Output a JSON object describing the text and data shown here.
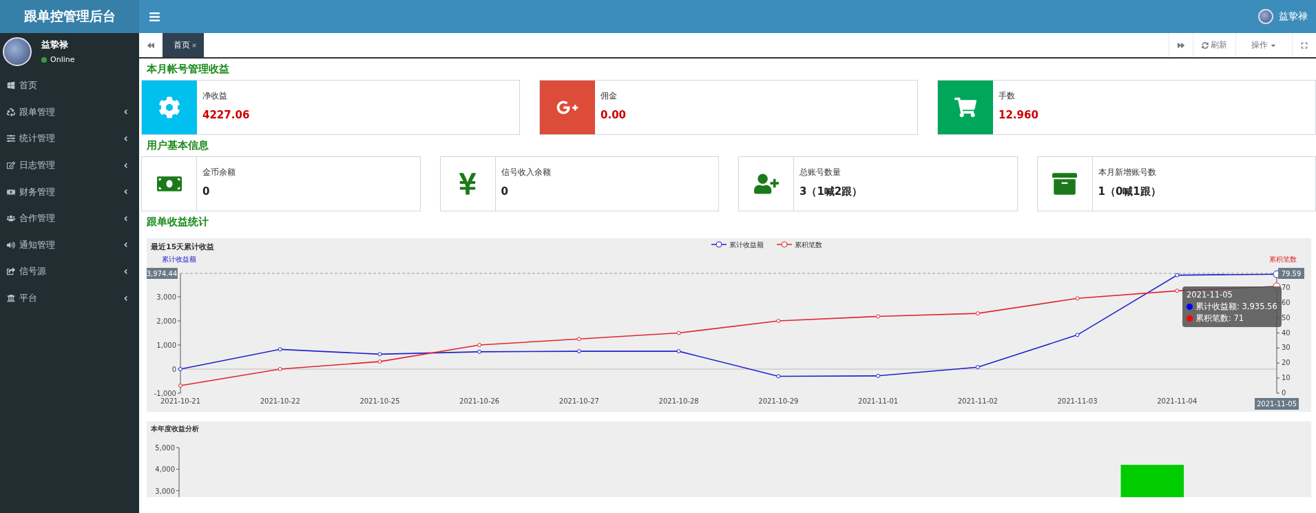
{
  "header": {
    "logo": "跟单控管理后台",
    "user_name": "益挚禄"
  },
  "sidebar": {
    "user": {
      "name": "益挚禄",
      "status": "Online",
      "online": true
    },
    "items": [
      {
        "label": "首页",
        "expandable": false
      },
      {
        "label": "跟单管理",
        "expandable": true
      },
      {
        "label": "统计管理",
        "expandable": true
      },
      {
        "label": "日志管理",
        "expandable": true
      },
      {
        "label": "财务管理",
        "expandable": true
      },
      {
        "label": "合作管理",
        "expandable": true
      },
      {
        "label": "通知管理",
        "expandable": true
      },
      {
        "label": "信号源",
        "expandable": true
      },
      {
        "label": "平台",
        "expandable": true
      }
    ]
  },
  "tab_bar": {
    "tabs": [
      {
        "label": "首页",
        "selected": true
      }
    ],
    "refresh": "刷新",
    "actions": "操作"
  },
  "sections": [
    {
      "title": "本月帐号管理收益",
      "kind": "colored",
      "cards": [
        {
          "label": "净收益",
          "value": "4227.06",
          "color": "#00c0ef"
        },
        {
          "label": "佣金",
          "value": "0.00",
          "color": "#dd4b39"
        },
        {
          "label": "手数",
          "value": "12.960",
          "color": "#00a65a"
        }
      ]
    },
    {
      "title": "用户基本信息",
      "kind": "plain",
      "cards": [
        {
          "label": "金币余额",
          "value": "0"
        },
        {
          "label": "信号收入余额",
          "value": "0"
        },
        {
          "label": "总账号数量",
          "value": "3（1喊2跟）"
        },
        {
          "label": "本月新增账号数",
          "value": "1（0喊1跟）"
        }
      ]
    },
    {
      "title": "跟单收益统计",
      "kind": "charts"
    }
  ],
  "charts": [
    {
      "chart_data": {
        "type": "line",
        "title": "最近15天累计收益",
        "categories": [
          "2021-10-21",
          "2021-10-22",
          "2021-10-25",
          "2021-10-26",
          "2021-10-27",
          "2021-10-28",
          "2021-10-29",
          "2021-11-01",
          "2021-11-02",
          "2021-11-03",
          "2021-11-04",
          "2021-11-05"
        ],
        "ylabel": "累计收益额",
        "y2label": "累积笔数",
        "ylim": [
          -1000,
          3974.44
        ],
        "yticks": [
          {
            "value": -1000,
            "label": "-1,000"
          },
          0,
          {
            "value": 1000,
            "label": "1,000"
          },
          {
            "value": 2000,
            "label": "2,000"
          },
          {
            "value": 3000,
            "label": "3,000"
          }
        ],
        "y2lim": [
          0,
          79.59
        ],
        "y2ticks": [
          0,
          10,
          20,
          30,
          40,
          50,
          60,
          70
        ],
        "legend": "top",
        "series": [
          {
            "name": "累计收益额",
            "color": "#2020cc",
            "marker": "circle",
            "values": [
              0,
              820,
              620,
              720,
              740,
              740,
              -300,
              -280,
              80,
              1420,
              3900,
              3940
            ]
          },
          {
            "name": "累积笔数",
            "color": "#e02530",
            "axis": "y2",
            "marker": "circle",
            "values": [
              5,
              16,
              21,
              32,
              36,
              40,
              48,
              51,
              53,
              63,
              68,
              71
            ]
          }
        ]
      },
      "pointer": {
        "y_label": "3,974.44",
        "y2_label": "79.59",
        "x_highlight": true
      },
      "tooltip": {
        "title": "2021-11-05",
        "lines": [
          "累计收益额: 3,935.56",
          "累积笔数: 71"
        ]
      }
    },
    {
      "chart_data": {
        "type": "bar",
        "title": "本年度收益分析",
        "ylim": [
          2700,
          5000
        ],
        "yticks": [
          {
            "value": 3000,
            "label": "3,000"
          },
          {
            "value": 4000,
            "label": "4,000"
          },
          {
            "value": 5000,
            "label": "5,000"
          }
        ],
        "series": [
          {
            "color": "#00cc00",
            "values": [
              null,
              null,
              null,
              null,
              null,
              null,
              null,
              null,
              null,
              null,
              4200,
              null
            ]
          }
        ]
      }
    }
  ]
}
